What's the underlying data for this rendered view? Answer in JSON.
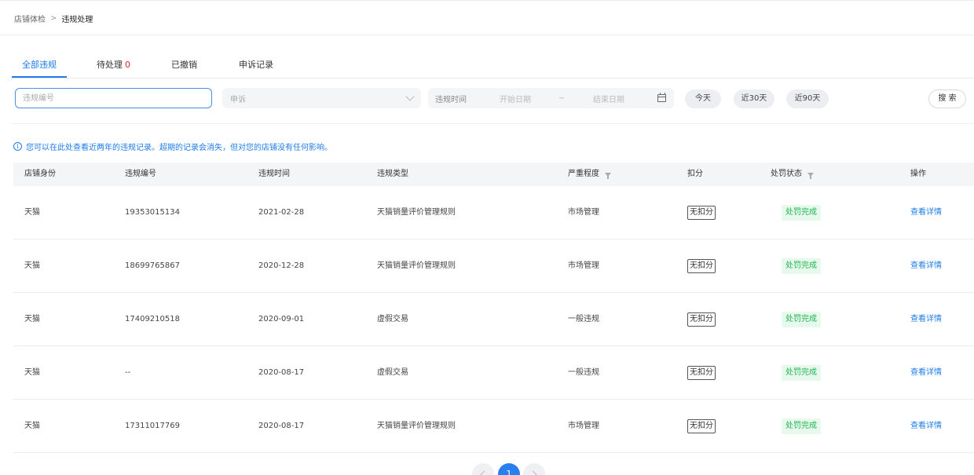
{
  "breadcrumb": {
    "parent": "店铺体检",
    "separator": ">",
    "current": "违规处理"
  },
  "tabs": [
    {
      "label": "全部违规",
      "count": ""
    },
    {
      "label": "待处理",
      "count": "0"
    },
    {
      "label": "已撤销",
      "count": ""
    },
    {
      "label": "申诉记录",
      "count": ""
    }
  ],
  "filters": {
    "id_placeholder": "违规编号",
    "appeal_placeholder": "申诉",
    "date_label": "违规时间",
    "start_placeholder": "开始日期",
    "range_separator": "~",
    "end_placeholder": "结束日期",
    "quick": [
      "今天",
      "近30天",
      "近90天"
    ],
    "search_label": "搜 索"
  },
  "notice": {
    "icon": "i",
    "text": "您可以在此处查看近两年的违规记录。超期的记录会消失，但对您的店铺没有任何影响。"
  },
  "table": {
    "headers": [
      "店铺身份",
      "违规编号",
      "违规时间",
      "违规类型",
      "严重程度",
      "扣分",
      "处罚状态",
      "操作"
    ],
    "rows": [
      {
        "shop": "天猫",
        "id": "19353015134",
        "date": "2021-02-28",
        "type": "天猫销量评价管理规则",
        "severity": "市场管理",
        "score": "无扣分",
        "status": "处罚完成",
        "action": "查看详情"
      },
      {
        "shop": "天猫",
        "id": "18699765867",
        "date": "2020-12-28",
        "type": "天猫销量评价管理规则",
        "severity": "市场管理",
        "score": "无扣分",
        "status": "处罚完成",
        "action": "查看详情"
      },
      {
        "shop": "天猫",
        "id": "17409210518",
        "date": "2020-09-01",
        "type": "虚假交易",
        "severity": "一般违规",
        "score": "无扣分",
        "status": "处罚完成",
        "action": "查看详情"
      },
      {
        "shop": "天猫",
        "id": "--",
        "date": "2020-08-17",
        "type": "虚假交易",
        "severity": "一般违规",
        "score": "无扣分",
        "status": "处罚完成",
        "action": "查看详情"
      },
      {
        "shop": "天猫",
        "id": "17311017769",
        "date": "2020-08-17",
        "type": "天猫销量评价管理规则",
        "severity": "市场管理",
        "score": "无扣分",
        "status": "处罚完成",
        "action": "查看详情"
      }
    ]
  },
  "pagination": {
    "current": "1"
  },
  "colors": {
    "accent": "#1f7ce8",
    "danger": "#e02020",
    "success": "#23b553",
    "success_bg": "#e7f9ec"
  }
}
